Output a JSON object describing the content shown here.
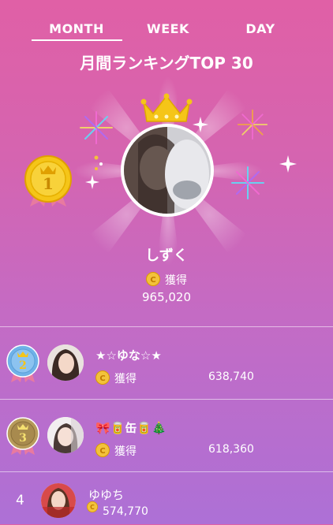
{
  "tabs": [
    {
      "label": "MONTH",
      "active": true
    },
    {
      "label": "WEEK",
      "active": false
    },
    {
      "label": "DAY",
      "active": false
    }
  ],
  "page_title": "月間ランキングTOP 30",
  "top": {
    "rank": "1",
    "name": "しずく",
    "earn_label": "獲得",
    "value": "965,020"
  },
  "rows": [
    {
      "rank": "2",
      "name": "★☆ゆな☆★",
      "earn_label": "獲得",
      "value": "638,740"
    },
    {
      "rank": "3",
      "name": "🎀🥫缶🥫🎄",
      "earn_label": "獲得",
      "value": "618,360"
    },
    {
      "rank": "4",
      "name": "ゆゆち",
      "value": "574,770"
    }
  ],
  "colors": {
    "gold": "#f5c518",
    "silver_blue": "#6fb2e8",
    "bronze": "#b79a5a",
    "coin": "#f3c23b"
  }
}
